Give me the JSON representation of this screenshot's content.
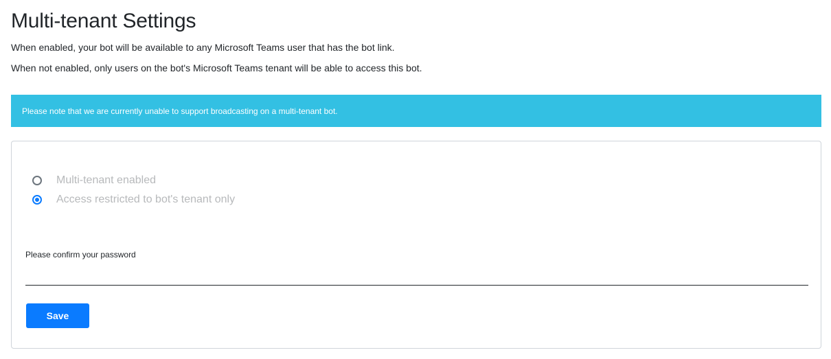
{
  "header": {
    "title": "Multi-tenant Settings",
    "description_enabled": "When enabled, your bot will be available to any Microsoft Teams user that has the bot link.",
    "description_disabled": "When not enabled, only users on the bot's Microsoft Teams tenant will be able to access this bot."
  },
  "alert": {
    "text": "Please note that we are currently unable to support broadcasting on a multi-tenant bot.",
    "color": "#33c0e3"
  },
  "form": {
    "options": [
      {
        "label": "Multi-tenant enabled",
        "selected": false
      },
      {
        "label": "Access restricted to bot's tenant only",
        "selected": true
      }
    ],
    "password_label": "Please confirm your password",
    "password_value": "",
    "save_label": "Save",
    "accent_color": "#0a7bff"
  }
}
